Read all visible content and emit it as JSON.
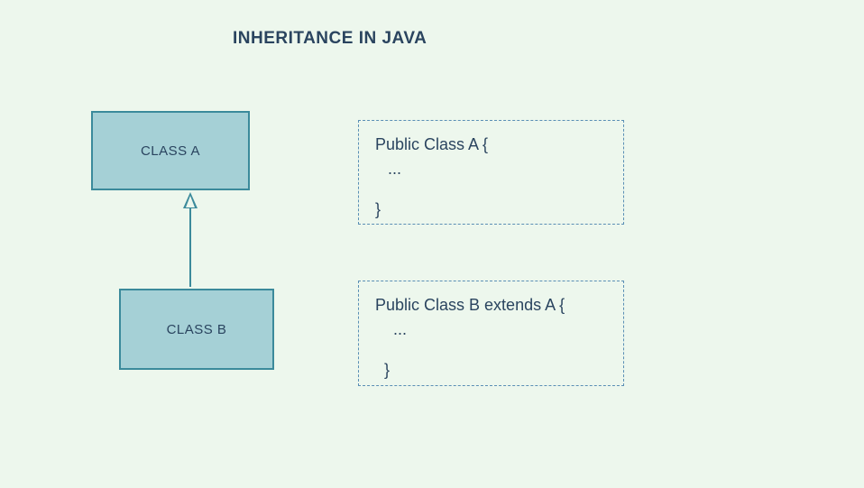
{
  "title": "INHERITANCE IN JAVA",
  "boxes": {
    "classA": "CLASS A",
    "classB": "CLASS B"
  },
  "code": {
    "a": {
      "line1": "Public Class A {",
      "line2": "...",
      "line3": "}"
    },
    "b": {
      "line1": "Public Class B extends A {",
      "line2": "...",
      "line3": "}"
    }
  },
  "colors": {
    "background": "#edf7ed",
    "boxFill": "#a5d0d6",
    "boxBorder": "#3b8a9b",
    "textDark": "#2a445f",
    "dashBorder": "#5a8fb5"
  }
}
